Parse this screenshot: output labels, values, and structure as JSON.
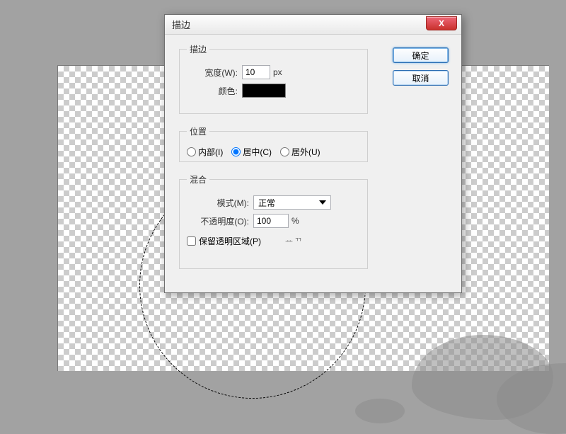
{
  "dialog": {
    "title": "描边",
    "close_glyph": "X",
    "buttons": {
      "ok": "确定",
      "cancel": "取消"
    }
  },
  "stroke": {
    "legend": "描边",
    "width_label": "宽度(W):",
    "width_value": "10",
    "width_unit": "px",
    "color_label": "颜色:",
    "color_value": "#000000"
  },
  "position": {
    "legend": "位置",
    "options": {
      "inside": "内部(I)",
      "center": "居中(C)",
      "outside": "居外(U)"
    },
    "selected": "center"
  },
  "blend": {
    "legend": "混合",
    "mode_label": "模式(M):",
    "mode_value": "正常",
    "opacity_label": "不透明度(O):",
    "opacity_value": "100",
    "opacity_unit": "%",
    "preserve_label": "保留透明区域(P)",
    "preserve_checked": false,
    "trailing_text": "ᅭᄁ"
  }
}
